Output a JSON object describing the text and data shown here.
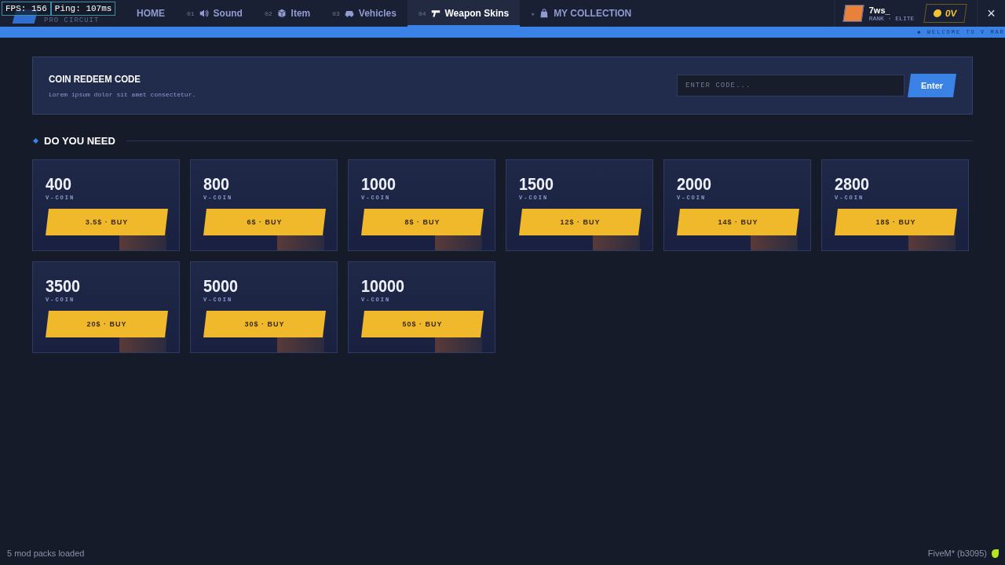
{
  "overlay": {
    "fps": "FPS: 156",
    "ping": "Ping: 107ms"
  },
  "logo": {
    "subtitle": "PRO CIRCUIT"
  },
  "nav": [
    {
      "label": "HOME",
      "selected": false
    },
    {
      "number": "01",
      "label": "Sound",
      "selected": false
    },
    {
      "number": "02",
      "label": "Item",
      "selected": false
    },
    {
      "number": "03",
      "label": "Vehicles",
      "selected": false
    },
    {
      "number": "04",
      "label": "Weapon Skins",
      "selected": true
    },
    {
      "number": "★",
      "label": "MY COLLECTION",
      "selected": false
    }
  ],
  "user": {
    "name": "7ws_",
    "rank": "RANK · ELITE",
    "balance": "0V",
    "close": "×"
  },
  "ticker": "◆ WELCOME TO V MAR",
  "redeem": {
    "title": "COIN REDEEM CODE",
    "description": "Lorem ipsum dolor sit amet consectetur.",
    "placeholder": "ENTER CODE...",
    "button": "Enter"
  },
  "section_title": "DO YOU NEED",
  "packs": [
    {
      "amount": "400",
      "unit": "V-COIN",
      "button": "3.5$ · BUY"
    },
    {
      "amount": "800",
      "unit": "V-COIN",
      "button": "6$ · BUY"
    },
    {
      "amount": "1000",
      "unit": "V-COIN",
      "button": "8$ · BUY"
    },
    {
      "amount": "1500",
      "unit": "V-COIN",
      "button": "12$ · BUY"
    },
    {
      "amount": "2000",
      "unit": "V-COIN",
      "button": "14$ · BUY"
    },
    {
      "amount": "2800",
      "unit": "V-COIN",
      "button": "18$ · BUY"
    },
    {
      "amount": "3500",
      "unit": "V-COIN",
      "button": "20$ · BUY"
    },
    {
      "amount": "5000",
      "unit": "V-COIN",
      "button": "30$ · BUY"
    },
    {
      "amount": "10000",
      "unit": "V-COIN",
      "button": "50$ · BUY"
    }
  ],
  "status_bar": {
    "left": "5 mod packs loaded",
    "right": "FiveM* (b3095)"
  }
}
